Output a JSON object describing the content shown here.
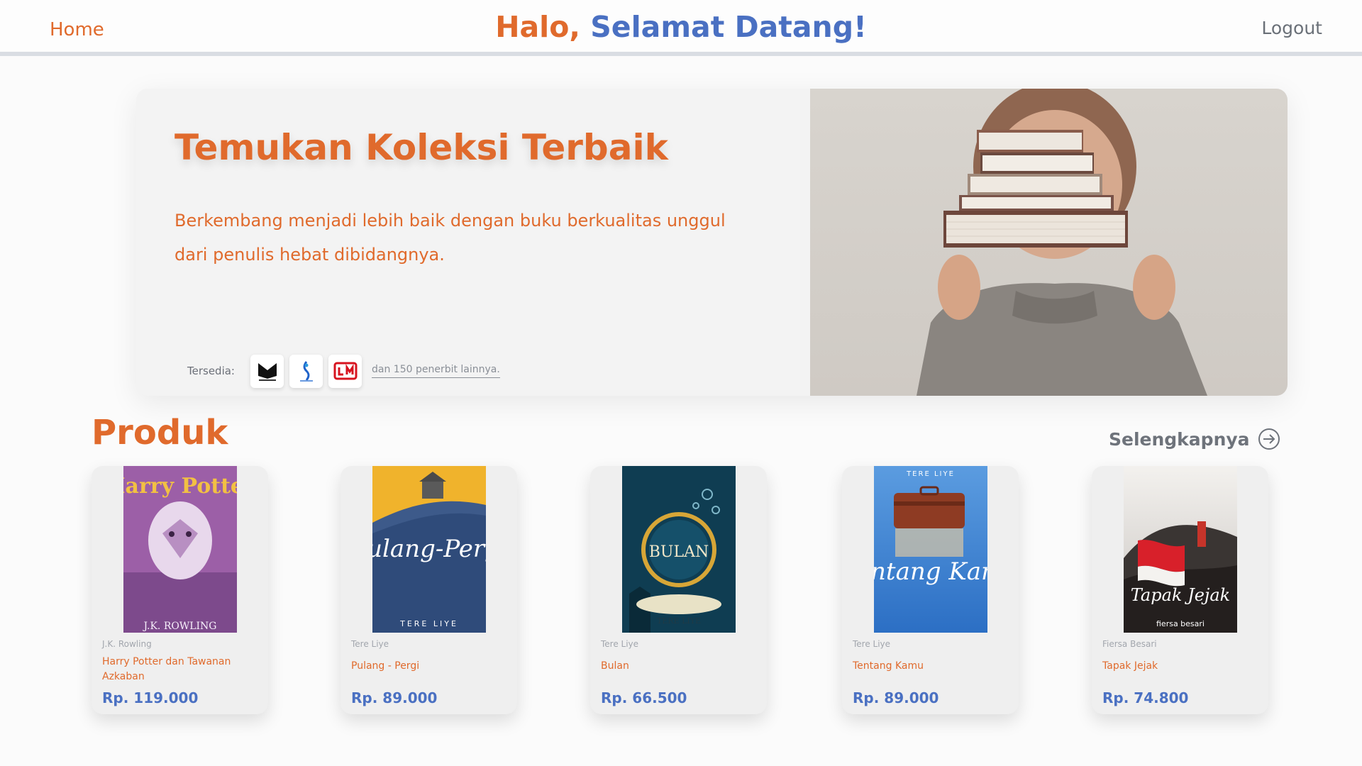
{
  "nav": {
    "home_label": "Home",
    "greeting_prefix": "Halo,",
    "greeting_main": "Selamat Datang!",
    "logout_label": "Logout"
  },
  "hero": {
    "title": "Temukan Koleksi Terbaik",
    "description": "Berkembang menjadi lebih baik dengan buku berkualitas unggul dari penulis hebat dibidangnya.",
    "availability_label": "Tersedia:",
    "publishers": [
      "mediakita",
      "bukuloma",
      "Gramedia"
    ],
    "availability_more": "dan 150 penerbit lainnya."
  },
  "products": {
    "title": "Produk",
    "see_more_label": "Selengkapnya",
    "items": [
      {
        "author": "J.K. Rowling",
        "title": "Harry Potter dan Tawanan Azkaban",
        "price": "Rp. 119.000",
        "cover_text": "Harry Potter",
        "cover_author": "J.K. ROWLING"
      },
      {
        "author": "Tere Liye",
        "title": "Pulang - Pergi",
        "price": "Rp. 89.000",
        "cover_text": "Pulang-Pergi",
        "cover_author": "TERE LIYE"
      },
      {
        "author": "Tere Liye",
        "title": "Bulan",
        "price": "Rp. 66.500",
        "cover_text": "BULAN",
        "cover_author": "TERE LIYE"
      },
      {
        "author": "Tere Liye",
        "title": "Tentang Kamu",
        "price": "Rp. 89.000",
        "cover_text": "Tentang Kamu",
        "cover_author": "TERE LIYE"
      },
      {
        "author": "Fiersa Besari",
        "title": "Tapak Jejak",
        "price": "Rp. 74.800",
        "cover_text": "Tapak Jejak",
        "cover_author": "fiersa besari"
      }
    ]
  },
  "colors": {
    "accent_orange": "#e06a2c",
    "accent_blue": "#4a70c2",
    "gray_text": "#6e737b"
  }
}
